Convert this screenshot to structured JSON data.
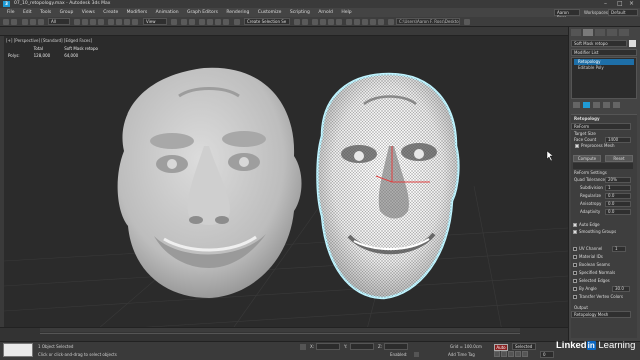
{
  "window": {
    "title": "07_10_retopology.max - Autodesk 3ds Max",
    "app_icon": "3ds-max-icon",
    "controls": [
      "minimize-icon",
      "maximize-icon",
      "close-icon"
    ]
  },
  "menu": {
    "items": [
      "File",
      "Edit",
      "Tools",
      "Group",
      "Views",
      "Create",
      "Modifiers",
      "Animation",
      "Graph Editors",
      "Rendering",
      "Customize",
      "Scripting",
      "Arnold",
      "Help"
    ],
    "user": "Aaron Ross",
    "workspaces_label": "Workspaces:",
    "workspace": "Default"
  },
  "toolbar": {
    "filter_dropdown": "All",
    "view_dropdown": "View",
    "selection_set": "Create Selection Se",
    "path": "C:\\Users\\Aaron F. Ross\\Desktop\\Exercise_Files"
  },
  "viewport": {
    "label": "[+] [Perspective] [Standard] [Edged Faces]",
    "stats": {
      "headers": [
        "",
        "Total",
        "Soft Mask retopo"
      ],
      "row_label": "Polys:",
      "row_values": [
        "128,000",
        "64,000"
      ]
    }
  },
  "command_panel": {
    "object_name": "Soft Mask retopo",
    "modifier_list_label": "Modifier List",
    "stack": [
      "Retopology",
      "Editable Poly"
    ],
    "rollout_title": "Retopology",
    "algorithm": "ReForm",
    "target_size_label": "Target Size",
    "face_count_label": "Face Count",
    "face_count_value": "1400",
    "preprocess_label": "Preprocess Mesh",
    "compute_button": "Compute",
    "reset_button": "Reset",
    "reform_settings_label": "ReForm Settings",
    "settings": [
      {
        "label": "Quad Tolerance",
        "value": "20%"
      },
      {
        "label": "Subdivision",
        "value": "1"
      },
      {
        "label": "Regularize",
        "value": "0.0"
      },
      {
        "label": "Anisotropy",
        "value": "0.0"
      },
      {
        "label": "Adaptivity",
        "value": "0.0"
      }
    ],
    "checks": [
      {
        "label": "Auto Edge",
        "checked": true
      },
      {
        "label": "Smoothing Groups",
        "checked": true
      },
      {
        "label": "UV Channel",
        "checked": false,
        "value": "1"
      },
      {
        "label": "Material IDs",
        "checked": false
      },
      {
        "label": "Boolean Seams",
        "checked": false
      },
      {
        "label": "Specified Normals",
        "checked": false
      },
      {
        "label": "Selected Edges",
        "checked": false
      },
      {
        "label": "By Angle",
        "checked": false,
        "value": "30.0"
      },
      {
        "label": "Transfer Vertex Colors",
        "checked": false
      }
    ],
    "output_label": "Output",
    "output_value": "Retopology Mesh"
  },
  "status": {
    "maxscript": "",
    "selection": "1 Object Selected",
    "prompt": "Click or click-and-drag to select objects",
    "x": "X:",
    "y": "Y:",
    "z": "Z:",
    "grid": "Grid = 100.0cm",
    "add_time_tag": "Add Time Tag",
    "selected": "Selected",
    "frame": "0",
    "enabled": "Enabled:",
    "colors": {
      "accent": "#1f9bd6",
      "selection_outline": "#bff4ff"
    }
  },
  "watermark": {
    "brand": "Linked",
    "badge": "in",
    "suffix": " Learning"
  }
}
